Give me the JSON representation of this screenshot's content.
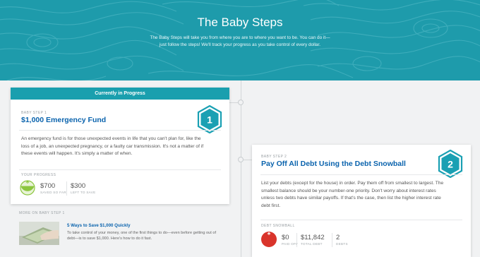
{
  "hero": {
    "title": "The Baby Steps",
    "subtitle_line1": "The Baby Steps will take you from where you are to where you want to be. You can do it—",
    "subtitle_line2": "just follow the steps! We'll track your progress as you take control of every dollar."
  },
  "current_step": {
    "banner": "Currently in Progress",
    "label": "BABY STEP 1",
    "title": "$1,000 Emergency Fund",
    "number": "1",
    "description_lines": [
      "An emergency fund is for those unexpected events in life that you can't plan for, like the",
      "loss of a job, an unexpected pregnancy, or a faulty car transmission. It's not a matter of if",
      "these events will happen. It's simply a matter of when."
    ],
    "progress_label": "YOUR PROGRESS",
    "saved_amount": "$700",
    "saved_label": "SAVED SO FAR",
    "left_amount": "$300",
    "left_label": "LEFT TO SAVE",
    "progress_fraction": 0.7,
    "gauge_color": "#8cc63f"
  },
  "more": {
    "label": "MORE ON BABY STEP 1",
    "article_title": "5 Ways to Save $1,000 Quickly",
    "article_desc_line1": "To take control of your money, one of the first things to do—even before getting out of",
    "article_desc_line2": "debt—is to save $1,000. Here's how to do it fast."
  },
  "next_step": {
    "label": "BABY STEP 2",
    "title": "Pay Off All Debt Using the Debt Snowball",
    "number": "2",
    "description_lines": [
      "List your debts (except for the house) in order. Pay them off from smallest to largest. The",
      "smallest balance should be your number-one priority. Don't worry about interest rates",
      "unless two debts have similar payoffs. If that's the case, then list the higher interest rate",
      "debt first."
    ],
    "snowball_label": "DEBT SNOWBALL",
    "paid_amount": "$0",
    "paid_label": "PAID OFF",
    "total_amount": "$11,842",
    "total_label": "TOTAL DEBT",
    "debts_count": "2",
    "debts_label": "DEBTS",
    "gauge_color": "#d9342b"
  },
  "colors": {
    "teal": "#1e9bab",
    "blue_title": "#0a63ad",
    "hex_blue": "#1aa0b3"
  },
  "icons": [
    "step-one-hex-icon",
    "step-two-hex-icon",
    "savings-gauge-icon",
    "debt-gauge-icon"
  ]
}
